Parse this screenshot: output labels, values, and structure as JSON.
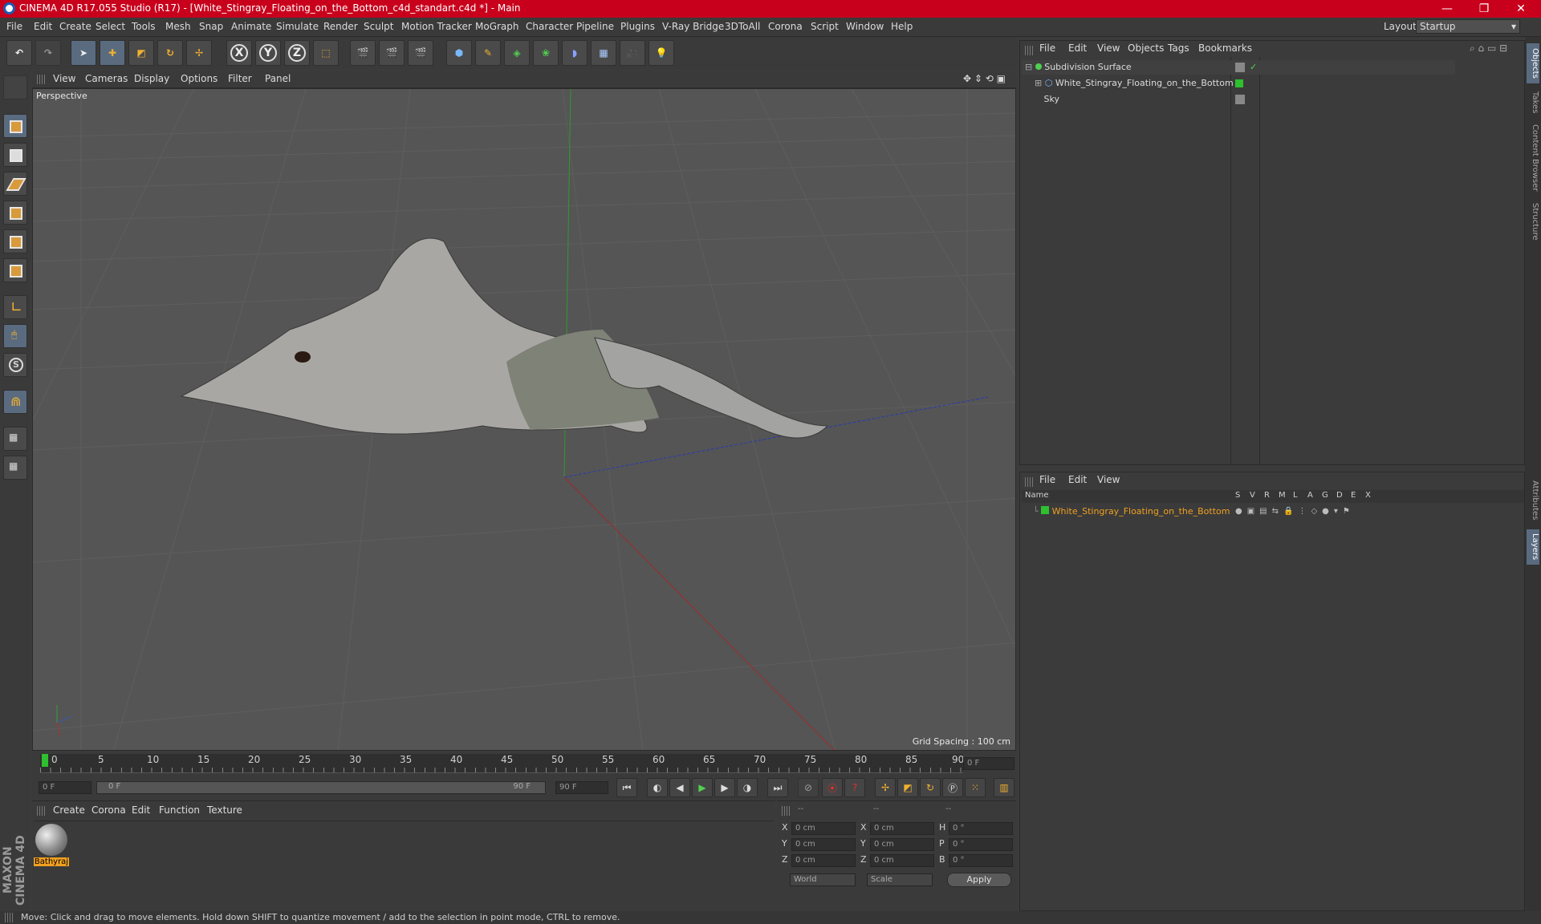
{
  "window": {
    "title": "CINEMA 4D R17.055 Studio (R17) - [White_Stingray_Floating_on_the_Bottom_c4d_standart.c4d *] - Main",
    "minimize": "—",
    "restore": "❐",
    "close": "✕"
  },
  "menubar": {
    "items": [
      "File",
      "Edit",
      "Create",
      "Select",
      "Tools",
      "Mesh",
      "Snap",
      "Animate",
      "Simulate",
      "Render",
      "Sculpt",
      "Motion Tracker",
      "MoGraph",
      "Character",
      "Pipeline",
      "Plugins",
      "V-Ray Bridge",
      "3DToAll",
      "Corona",
      "Script",
      "Window",
      "Help"
    ],
    "layout_label": "Layout:",
    "layout_value": "Startup"
  },
  "toolbar": {
    "axis_x": "X",
    "axis_y": "Y",
    "axis_z": "Z"
  },
  "viewport": {
    "menu": [
      "View",
      "Cameras",
      "Display",
      "Options",
      "Filter",
      "Panel"
    ],
    "label": "Perspective",
    "grid_spacing": "Grid Spacing : 100 cm"
  },
  "timeline": {
    "ticks": [
      "0",
      "5",
      "10",
      "15",
      "20",
      "25",
      "30",
      "35",
      "40",
      "45",
      "50",
      "55",
      "60",
      "65",
      "70",
      "75",
      "80",
      "85",
      "90"
    ],
    "end_frame_field": "0 F",
    "start_field": "0 F",
    "range_start": "0 F",
    "range_end": "90 F",
    "max_field": "90 F"
  },
  "materials": {
    "menu": [
      "Create",
      "Corona",
      "Edit",
      "Function",
      "Texture"
    ],
    "items": [
      {
        "name": "Bathyraj"
      }
    ]
  },
  "coords": {
    "headers": [
      "--",
      "--",
      "--"
    ],
    "rows": [
      {
        "a": "X",
        "av": "0 cm",
        "b": "X",
        "bv": "0 cm",
        "c": "H",
        "cv": "0 °"
      },
      {
        "a": "Y",
        "av": "0 cm",
        "b": "Y",
        "bv": "0 cm",
        "c": "P",
        "cv": "0 °"
      },
      {
        "a": "Z",
        "av": "0 cm",
        "b": "Z",
        "bv": "0 cm",
        "c": "B",
        "cv": "0 °"
      }
    ],
    "world": "World",
    "scale": "Scale",
    "apply": "Apply"
  },
  "object_manager": {
    "menu": [
      "File",
      "Edit",
      "View",
      "Objects",
      "Tags",
      "Bookmarks"
    ],
    "objects": [
      {
        "name": "Subdivision Surface"
      },
      {
        "name": "White_Stingray_Floating_on_the_Bottom"
      },
      {
        "name": "Sky"
      }
    ]
  },
  "layer_manager": {
    "menu": [
      "File",
      "Edit",
      "View"
    ],
    "columns": [
      "Name",
      "S",
      "V",
      "R",
      "M",
      "L",
      "A",
      "G",
      "D",
      "E",
      "X"
    ],
    "layers": [
      {
        "name": "White_Stingray_Floating_on_the_Bottom"
      }
    ]
  },
  "right_tabs": [
    "Objects",
    "Takes",
    "Content Browser",
    "Structure",
    "Attributes",
    "Layers"
  ],
  "status": "Move: Click and drag to move elements. Hold down SHIFT to quantize movement / add to the selection in point mode, CTRL to remove.",
  "colors": {
    "title_bar": "#c8001c",
    "layer_green": "#2ec02e",
    "layer_name": "#f0a020",
    "accent_orange": "#d89a3a"
  }
}
